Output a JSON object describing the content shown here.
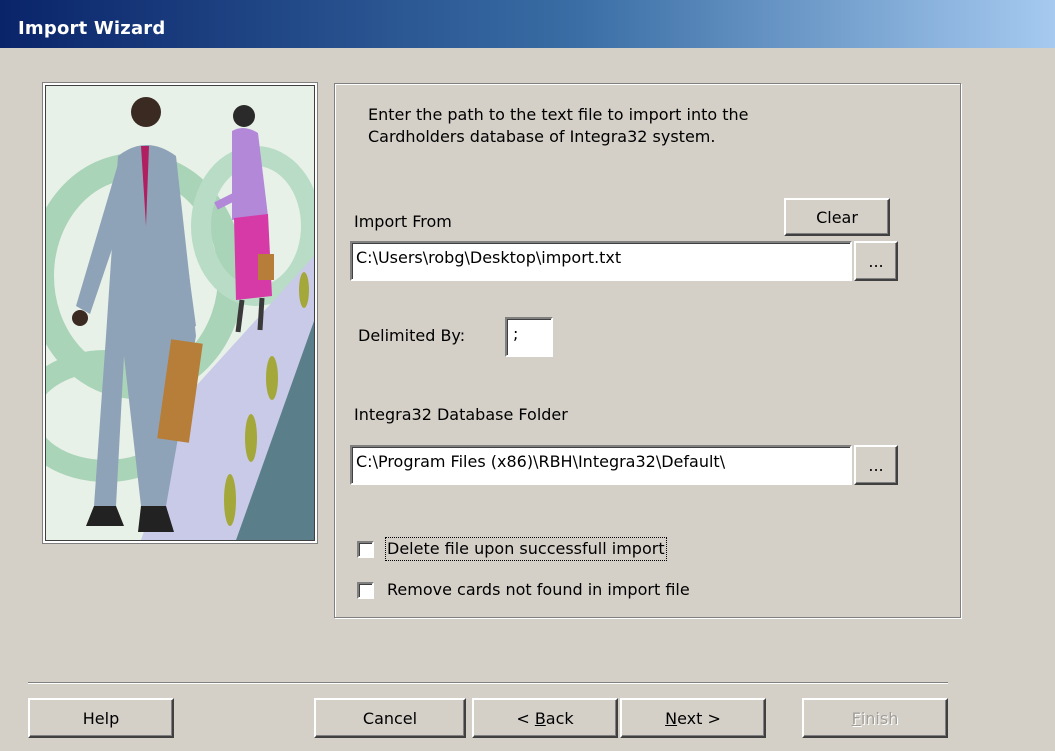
{
  "window": {
    "title": "Import Wizard"
  },
  "instructions": {
    "line1": "Enter the path to the text file to import into the",
    "line2": "Cardholders database of Integra32 system."
  },
  "import_from": {
    "label": "Import From",
    "value": "C:\\Users\\robg\\Desktop\\import.txt",
    "clear_label": "Clear",
    "browse_label": "..."
  },
  "delimiter": {
    "label": "Delimited By:",
    "value": ";"
  },
  "database_folder": {
    "label": "Integra32 Database Folder",
    "value": "C:\\Program Files (x86)\\RBH\\Integra32\\Default\\",
    "browse_label": "..."
  },
  "options": [
    {
      "label": "Delete file upon successfull import",
      "checked": false
    },
    {
      "label": "Remove cards not found in import file",
      "checked": false
    }
  ],
  "buttons": {
    "help": "Help",
    "cancel": "Cancel",
    "back_prefix": "< ",
    "back_key": "B",
    "back_rest": "ack",
    "next_key": "N",
    "next_rest": "ext >",
    "finish_key": "F",
    "finish_rest": "inish"
  },
  "colors": {
    "dialog_bg": "#d4d0c8",
    "title_start": "#0a246a",
    "title_end": "#a6caf0"
  },
  "icons": {
    "illustration": "business-people-walkway-illustration"
  }
}
